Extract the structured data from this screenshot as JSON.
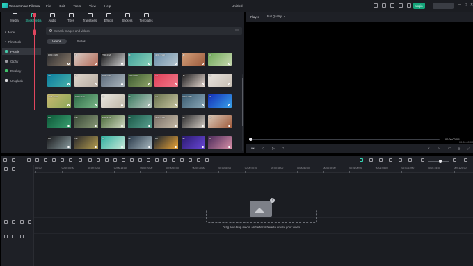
{
  "titlebar": {
    "app_name": "Wondershare Filmora",
    "menu": [
      "File",
      "Edit",
      "Tools",
      "View",
      "Help"
    ],
    "doc_title": "Untitled",
    "login_label": "Login",
    "icons": [
      "monitor-icon",
      "save-icon",
      "cloud-icon",
      "message-icon",
      "grid-icon"
    ]
  },
  "library": {
    "categories": [
      {
        "label": "Media",
        "icon": "media-icon"
      },
      {
        "label": "Stock Media",
        "icon": "stock-media-icon"
      },
      {
        "label": "Audio",
        "icon": "music-note-icon"
      },
      {
        "label": "Titles",
        "icon": "text-icon"
      },
      {
        "label": "Transitions",
        "icon": "transitions-icon"
      },
      {
        "label": "Effects",
        "icon": "effects-icon"
      },
      {
        "label": "Stickers",
        "icon": "sticker-icon"
      },
      {
        "label": "Templates",
        "icon": "templates-icon"
      }
    ],
    "active_category": "Stock Media",
    "sidebar": [
      {
        "label": "Mine"
      },
      {
        "label": "Filmstock"
      },
      {
        "label": "Pexels"
      },
      {
        "label": "Giphy"
      },
      {
        "label": "Pixabay"
      },
      {
        "label": "Unsplash"
      }
    ],
    "active_sidebar": "Pexels",
    "search_placeholder": "Search images and videos",
    "tabs": [
      "Videos",
      "Photos"
    ],
    "active_tab": "Videos",
    "thumbnails": [
      {
        "res": "1080×1920",
        "c1": "#2a2b2e",
        "c2": "#8a7a6a"
      },
      {
        "res": "HD",
        "c1": "#d8cbc4",
        "c2": "#b46c5a"
      },
      {
        "res": "2700×1920",
        "c1": "#0e0e10",
        "c2": "#cfcfcf"
      },
      {
        "res": "HD",
        "c1": "#3fa09a",
        "c2": "#8ad0b8"
      },
      {
        "res": "4096×2160",
        "c1": "#6a8ea8",
        "c2": "#b8c6d0"
      },
      {
        "res": "HD",
        "c1": "#d4a07a",
        "c2": "#9c5a3c"
      },
      {
        "res": "HD",
        "c1": "#6ea858",
        "c2": "#c8d8b0"
      },
      {
        "res": "HD",
        "c1": "#0a7da0",
        "c2": "#48b0a8"
      },
      {
        "res": "HD",
        "c1": "#ded6cc",
        "c2": "#b8ada2"
      },
      {
        "res": "4096×2160",
        "c1": "#5a6a7a",
        "c2": "#aab4bc"
      },
      {
        "res": "4096×2160",
        "c1": "#3c5a30",
        "c2": "#8fa468"
      },
      {
        "res": "HD",
        "c1": "#e0405a",
        "c2": "#f07888"
      },
      {
        "res": "HD",
        "c1": "#1a1a1c",
        "c2": "#e6d8d0"
      },
      {
        "res": "HD",
        "c1": "#e6e2dc",
        "c2": "#c8bfb4"
      },
      {
        "res": "4096×2160",
        "c1": "#c8b870",
        "c2": "#8aa858"
      },
      {
        "res": "4096×2160",
        "c1": "#2e6c48",
        "c2": "#7ab888"
      },
      {
        "res": "HD",
        "c1": "#e8e6e0",
        "c2": "#c0b8a8"
      },
      {
        "res": "HD",
        "c1": "#3a7a60",
        "c2": "#b8c8c0"
      },
      {
        "res": "HD",
        "c1": "#6a7450",
        "c2": "#c8c4a0"
      },
      {
        "res": "1920×1080",
        "c1": "#3a5a70",
        "c2": "#8aa8b8"
      },
      {
        "res": "HD",
        "c1": "#1430b8",
        "c2": "#38a0e8"
      },
      {
        "res": "HD",
        "c1": "#0e5a3a",
        "c2": "#3aa070"
      },
      {
        "res": "HD",
        "c1": "#3a4a38",
        "c2": "#8a9a78"
      },
      {
        "res": "4096×2160",
        "c1": "#4a6a3a",
        "c2": "#d0d8c0"
      },
      {
        "res": "HD",
        "c1": "#1a5a48",
        "c2": "#5aa090"
      },
      {
        "res": "4096×2160",
        "c1": "#7a7068",
        "c2": "#c8bca8"
      },
      {
        "res": "HD",
        "c1": "#2a2a2c",
        "c2": "#d8d0c8"
      },
      {
        "res": "HD",
        "c1": "#d8c8b8",
        "c2": "#a05a3a"
      },
      {
        "res": "HD",
        "c1": "#1a1a1c",
        "c2": "#8a9ca0"
      },
      {
        "res": "HD",
        "c1": "#2a2a2c",
        "c2": "#b8a050"
      },
      {
        "res": "HD",
        "c1": "#30b0a0",
        "c2": "#c8e8d8"
      },
      {
        "res": "HD",
        "c1": "#283848",
        "c2": "#a8b8c0"
      },
      {
        "res": "HD",
        "c1": "#1a2430",
        "c2": "#f0a838"
      },
      {
        "res": "HD",
        "c1": "#2a1a70",
        "c2": "#6a48d8"
      },
      {
        "res": "HD",
        "c1": "#4a2a5a",
        "c2": "#d890a8"
      }
    ]
  },
  "player": {
    "label": "Player",
    "quality": "Full Quality",
    "time_current": "00:00:00:00",
    "time_total": "/ 00:00:00:00"
  },
  "timeline": {
    "ruler_ticks": [
      "00:00",
      "00:00:05:00",
      "00:00:10:00",
      "00:00:15:00",
      "00:00:20:00",
      "00:00:25:00",
      "00:00:30:00",
      "00:00:35:00",
      "00:00:40:00",
      "00:00:45:00",
      "00:00:50:00",
      "00:00:55:00",
      "00:01:00:00",
      "00:01:05:00",
      "00:01:10:00",
      "00:01:15:00",
      "00:01:20:00"
    ],
    "drop_hint": "Drag and drop media and effects here to create your video."
  }
}
